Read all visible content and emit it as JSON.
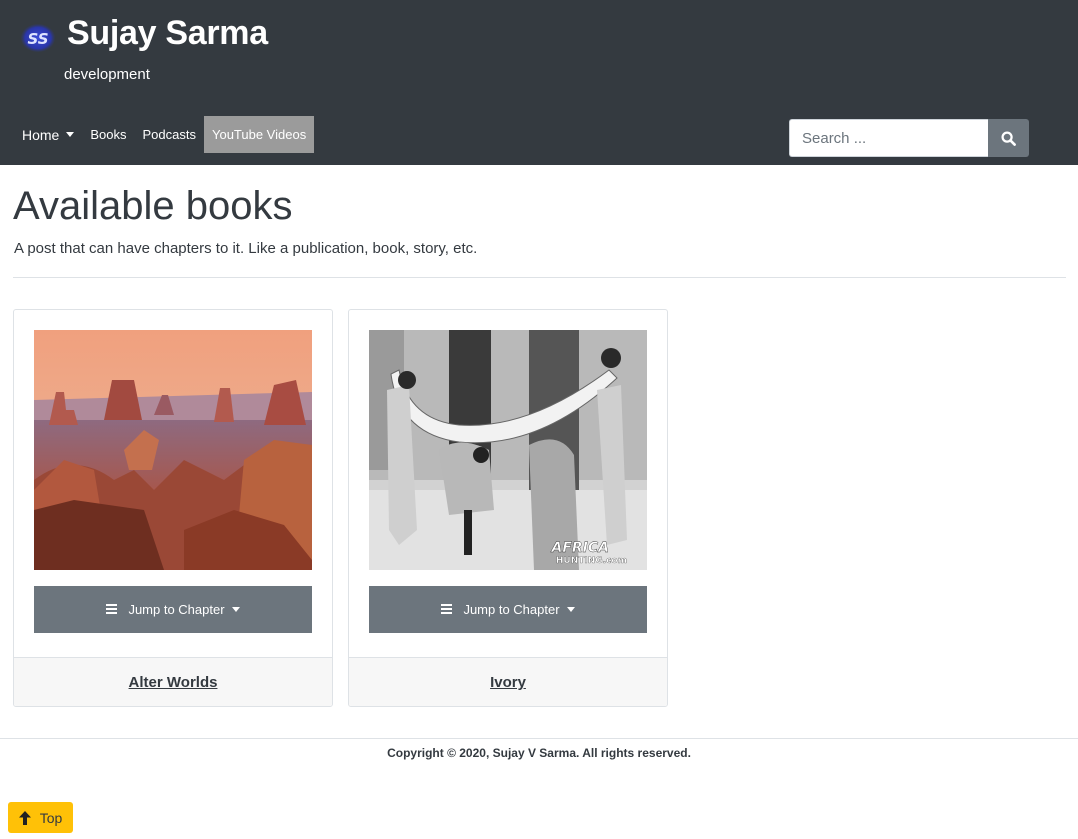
{
  "site": {
    "title": "Sujay Sarma",
    "description": "development",
    "logo_icon": "ss-logo-icon"
  },
  "nav": {
    "items": [
      {
        "label": "Home",
        "has_dropdown": true
      },
      {
        "label": "Books"
      },
      {
        "label": "Podcasts"
      },
      {
        "label": "YouTube Videos",
        "active": true
      }
    ]
  },
  "search": {
    "placeholder": "Search ...",
    "value": "",
    "icon": "search-icon"
  },
  "main": {
    "title": "Available books",
    "description": "A post that can have chapters to it. Like a publication, book, story, etc."
  },
  "books": [
    {
      "title": "Alter Worlds",
      "jump_label": "Jump to Chapter",
      "image": "canyon-landscape"
    },
    {
      "title": "Ivory",
      "jump_label": "Jump to Chapter",
      "image": "ivory-tusk-photo",
      "watermark": "AFRICA HUNTING.com"
    }
  ],
  "footer": {
    "copyright": "Copyright © 2020, Sujay V Sarma. All rights reserved."
  },
  "top_button": {
    "label": "Top",
    "icon": "arrow-up-icon"
  },
  "colors": {
    "header_bg": "#343a40",
    "nav_active_bg": "#9b9b9b",
    "button_gray": "#6c757d",
    "top_button": "#ffc107",
    "card_footer_bg": "#f7f7f7"
  }
}
